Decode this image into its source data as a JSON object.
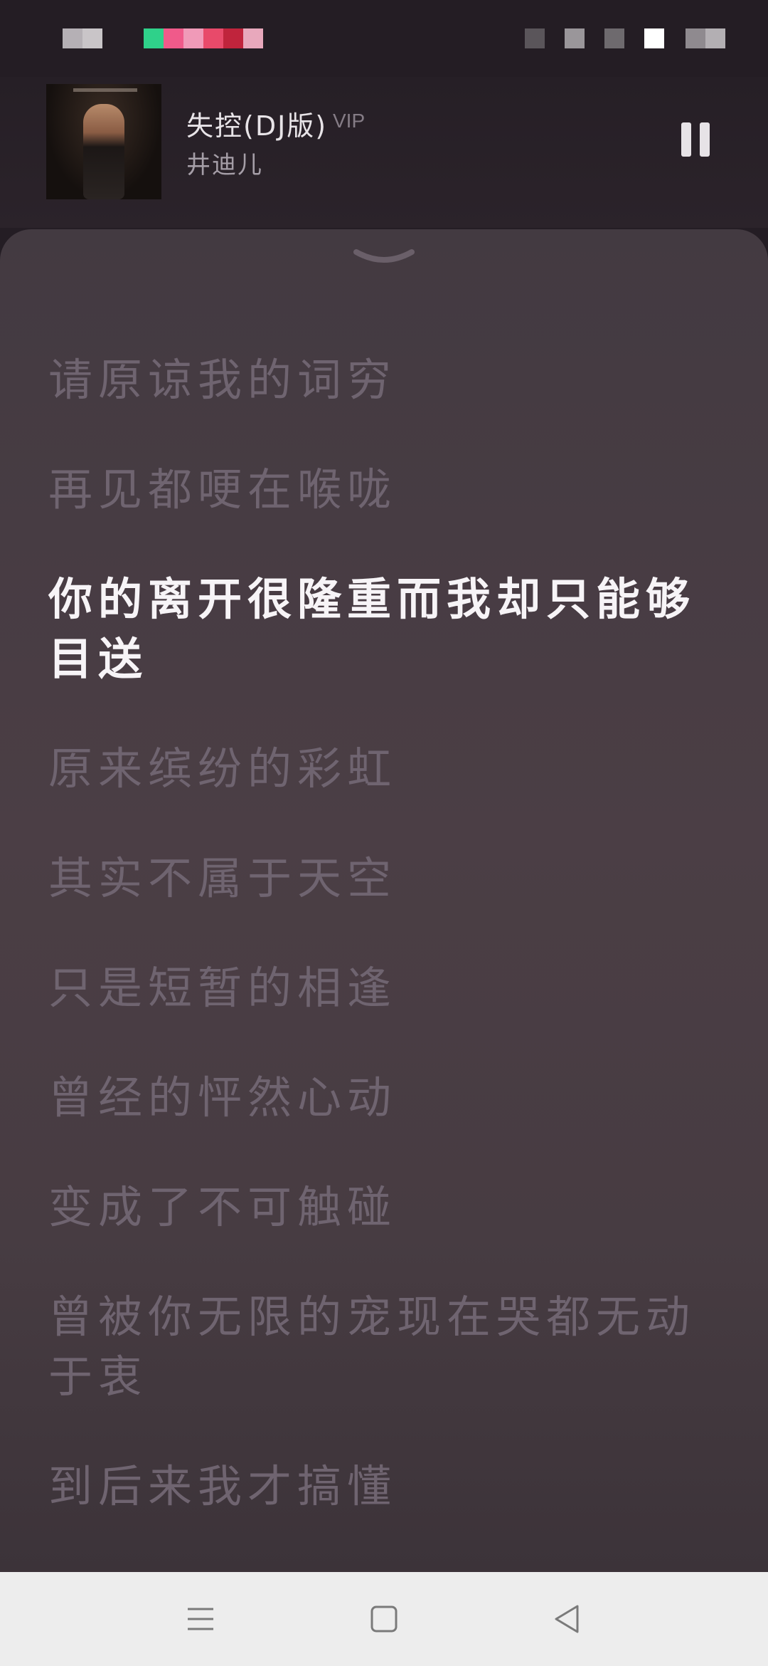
{
  "status_bar": {
    "blocks": [
      {
        "color": "#b5b0b5"
      },
      {
        "color": "#c9c5c8"
      },
      {
        "color": "#2fd18a"
      },
      {
        "color": "#f05a8a"
      },
      {
        "color": "#f09ab8"
      },
      {
        "color": "#e84a6a"
      },
      {
        "color": "#c0243c"
      },
      {
        "color": "#e8a8bc"
      },
      {
        "color": "#5a555a"
      },
      {
        "color": "#9a969a"
      },
      {
        "color": "#6e6a6e"
      },
      {
        "color": "#ffffff"
      },
      {
        "color": "#8f8a8f"
      },
      {
        "color": "#b3afb3"
      }
    ]
  },
  "now_playing": {
    "title": "失控(DJ版)",
    "badge": "VIP",
    "artist": "井迪儿",
    "state": "playing"
  },
  "lyrics": {
    "lines": [
      {
        "text": "请原谅我的词穷",
        "current": false
      },
      {
        "text": "再见都哽在喉咙",
        "current": false
      },
      {
        "text": "你的离开很隆重而我却只能够目送",
        "current": true
      },
      {
        "text": "原来缤纷的彩虹",
        "current": false
      },
      {
        "text": "其实不属于天空",
        "current": false
      },
      {
        "text": "只是短暂的相逢",
        "current": false
      },
      {
        "text": "曾经的怦然心动",
        "current": false
      },
      {
        "text": "变成了不可触碰",
        "current": false
      },
      {
        "text": "曾被你无限的宠现在哭都无动于衷",
        "current": false
      },
      {
        "text": "到后来我才搞懂",
        "current": false
      }
    ]
  },
  "colors": {
    "background": "#241d24",
    "panel": "#483c43",
    "lyric_inactive": "#6f6470",
    "lyric_active": "#f7f4f7"
  }
}
